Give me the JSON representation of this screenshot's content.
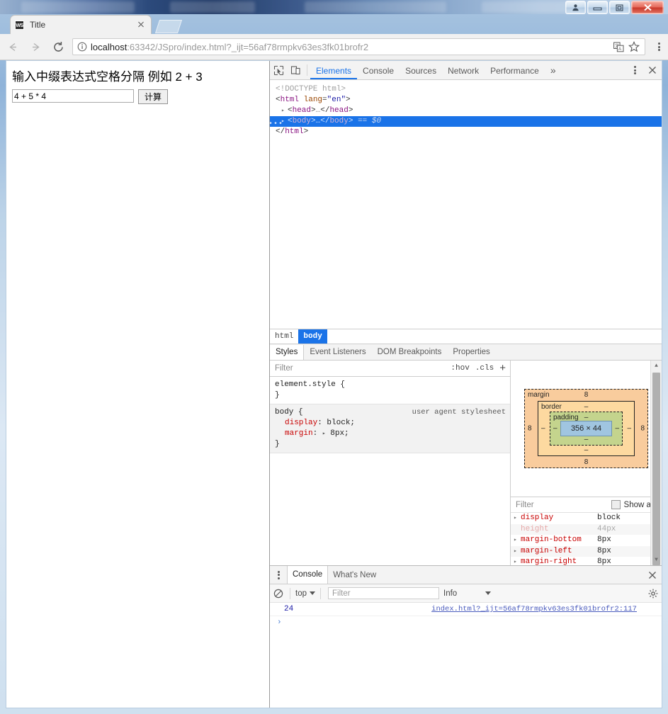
{
  "window": {
    "controls": [
      {
        "name": "user-account-button",
        "glyph": "person"
      },
      {
        "name": "minimize-button",
        "glyph": "minimize"
      },
      {
        "name": "restore-button",
        "glyph": "restore"
      },
      {
        "name": "close-button",
        "glyph": "close"
      }
    ]
  },
  "browser": {
    "tab": {
      "title": "Title",
      "favicon_text": "WS"
    },
    "new_tab_label": "",
    "nav": {
      "back": "back-icon",
      "forward": "forward-icon",
      "reload": "reload-icon"
    },
    "omnibox": {
      "info_icon": "info-circle-icon",
      "host": "localhost",
      "path": ":63342/JSpro/index.html?_ijt=56af78rmpkv63es3fk01brofr2",
      "translate_icon": "translate-icon",
      "bookmark_icon": "star-icon"
    },
    "menu_icon": "three-dot-menu-icon"
  },
  "page": {
    "heading": "输入中缀表达式空格分隔 例如 2 + 3",
    "input_value": "4 + 5 * 4",
    "input_placeholder": "",
    "button_label": "计算"
  },
  "devtools": {
    "toolbar": {
      "inspect_icon": "inspect-element-icon",
      "device_icon": "device-toolbar-icon",
      "tabs": [
        {
          "label": "Elements",
          "active": true
        },
        {
          "label": "Console",
          "active": false
        },
        {
          "label": "Sources",
          "active": false
        },
        {
          "label": "Network",
          "active": false
        },
        {
          "label": "Performance",
          "active": false
        }
      ],
      "more_label": "»",
      "settings_icon": "vertical-dots-icon",
      "close_icon": "close-icon"
    },
    "dom_tree": [
      {
        "indent": 0,
        "type": "doctype",
        "text": "<!DOCTYPE html>"
      },
      {
        "indent": 0,
        "type": "open",
        "tag": "html",
        "attr": "lang",
        "value": "\"en\""
      },
      {
        "indent": 1,
        "type": "collapsed",
        "tag": "head"
      },
      {
        "indent": 1,
        "type": "collapsed",
        "tag": "body",
        "selected": true,
        "suffix": "== $0"
      },
      {
        "indent": 0,
        "type": "close",
        "tag": "html"
      }
    ],
    "breadcrumb": [
      {
        "label": "html",
        "active": false
      },
      {
        "label": "body",
        "active": true
      }
    ],
    "sidebar_tabs": [
      {
        "label": "Styles",
        "active": true
      },
      {
        "label": "Event Listeners",
        "active": false
      },
      {
        "label": "DOM Breakpoints",
        "active": false
      },
      {
        "label": "Properties",
        "active": false
      }
    ],
    "styles_filter": {
      "placeholder": "Filter",
      "hov": ":hov",
      "cls": ".cls",
      "plus": "+"
    },
    "rules": [
      {
        "selector": "element.style {",
        "origin": "",
        "declarations": [],
        "close": "}"
      },
      {
        "selector": "body {",
        "origin": "user agent stylesheet",
        "declarations": [
          {
            "name": "display",
            "value": "block;",
            "arrow": false
          },
          {
            "name": "margin",
            "value": "8px;",
            "arrow": true
          }
        ],
        "close": "}"
      }
    ],
    "box_model": {
      "margin_label": "margin",
      "border_label": "border",
      "padding_label": "padding",
      "margin_top": "8",
      "margin_bottom": "8",
      "margin_left": "8",
      "margin_right": "8",
      "border_top": "–",
      "border_bottom": "–",
      "border_left": "–",
      "border_right": "–",
      "padding_top": "–",
      "padding_bottom": "–",
      "padding_left": "–",
      "padding_right": "–",
      "content": "356 × 44"
    },
    "computed_filter": {
      "placeholder": "Filter",
      "show_all_label": "Show all"
    },
    "computed_props": [
      {
        "name": "display",
        "value": "block",
        "inherited": false,
        "expandable": true
      },
      {
        "name": "height",
        "value": "44px",
        "inherited": true,
        "expandable": false
      },
      {
        "name": "margin-bottom",
        "value": "8px",
        "inherited": false,
        "expandable": true
      },
      {
        "name": "margin-left",
        "value": "8px",
        "inherited": false,
        "expandable": true
      },
      {
        "name": "margin-right",
        "value": "8px",
        "inherited": false,
        "expandable": true
      }
    ],
    "drawer": {
      "menu_icon": "vertical-dots-icon",
      "tabs": [
        {
          "label": "Console",
          "active": true
        },
        {
          "label": "What's New",
          "active": false
        }
      ],
      "close_icon": "close-icon",
      "clear_icon": "clear-console-icon",
      "context": "top",
      "filter_placeholder": "Filter",
      "level": "Info",
      "settings_icon": "gear-icon",
      "messages": [
        {
          "value": "24",
          "source": "index.html?_ijt=56af78rmpkv63es3fk01brofr2:117"
        }
      ],
      "prompt": "›"
    }
  },
  "colors": {
    "accent_blue": "#1a73e8",
    "selection_blue": "#1a73e8",
    "margin_box": "#f9cc9d",
    "border_box": "#fdd9a0",
    "padding_box": "#c4d48d",
    "content_box": "#a0c5e0",
    "close_red": "#c8382a",
    "prop_red": "#c80000"
  }
}
